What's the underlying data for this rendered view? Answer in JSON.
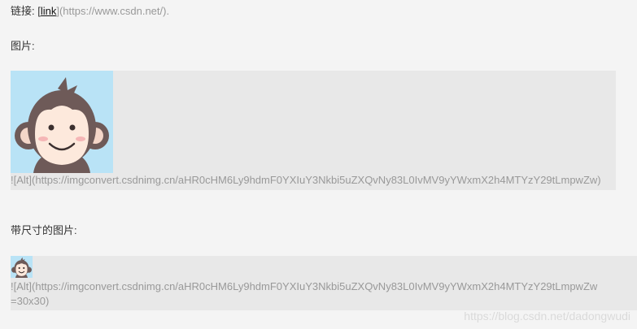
{
  "link_section": {
    "prefix": "链接: [",
    "link_text": "link",
    "url_suffix": "](https://www.csdn.net/)."
  },
  "image_section": {
    "label": "图片:",
    "alt_markdown": "![Alt](https://imgconvert.csdnimg.cn/aHR0cHM6Ly9hdmF0YXIuY3Nkbi5uZXQvNy83L0IvMV9yYWxmX2h4MTYzY29tLmpwZw)"
  },
  "sized_image_section": {
    "label": "带尺寸的图片:",
    "alt_markdown_line1": "![Alt](https://imgconvert.csdnimg.cn/aHR0cHM6Ly9hdmF0YXIuY3Nkbi5uZXQvNy83L0IvMV9yYWxmX2h4MTYzY29tLmpwZw",
    "alt_markdown_line2": "=30x30)"
  },
  "watermark": {
    "text": "https://blog.csdn.net/dadongwudi"
  },
  "colors": {
    "page_bg": "#f4f4f4",
    "image_block_bg": "#e8e8e8",
    "avatar_bg": "#b9e3f6",
    "muted_text": "#999999"
  },
  "icons": {
    "avatar": "monkey-avatar-icon"
  }
}
